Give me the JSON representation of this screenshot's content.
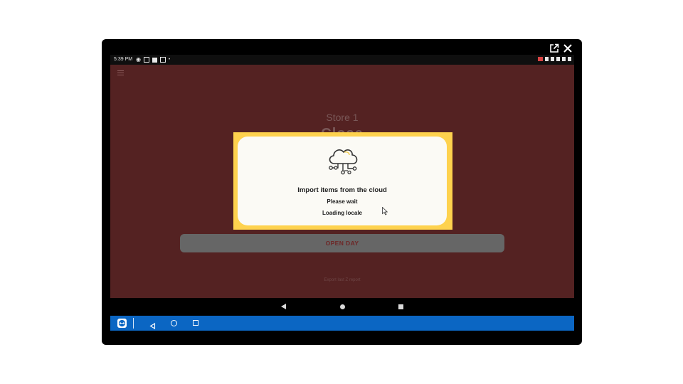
{
  "statusbar": {
    "time": "5:39 PM"
  },
  "app": {
    "store_name": "Store 1",
    "day_status": "Close",
    "open_day_label": "OPEN DAY",
    "export_label": "Export last Z report"
  },
  "dialog": {
    "title": "Import items from the cloud",
    "subtitle": "Please wait",
    "progress": "Loading locale"
  },
  "colors": {
    "app_background": "#542222",
    "highlight": "#fed24e",
    "teamviewer_bar": "#0b66c3"
  },
  "icons": {
    "window": [
      "open-external-icon",
      "close-icon"
    ],
    "dialog": "cloud-network-icon",
    "app": "hamburger-menu-icon",
    "teamviewer": "teamviewer-logo-icon"
  }
}
